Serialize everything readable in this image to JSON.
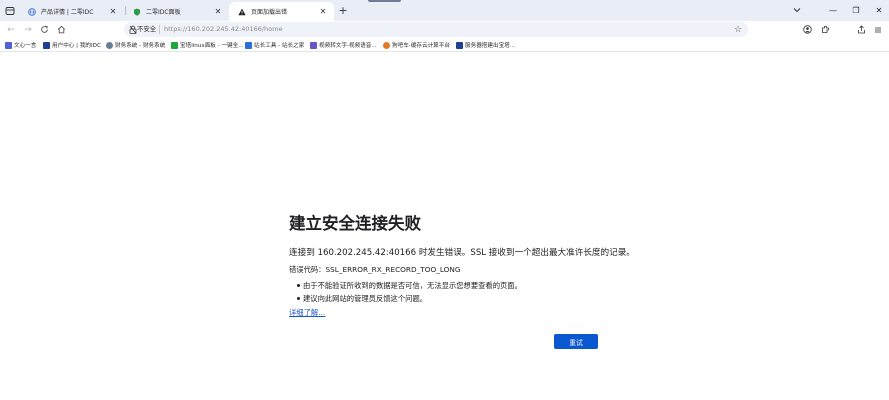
{
  "tabs": [
    {
      "title": "产品详情 | 二零IDC",
      "active": false,
      "icon": "globe-icon"
    },
    {
      "title": "二零IDC面板",
      "active": false,
      "icon": "shield-icon"
    },
    {
      "title": "页面加载出错",
      "active": true,
      "icon": "warning-icon"
    }
  ],
  "window": {
    "minimize": "—",
    "maximize": "❐",
    "close": "✕"
  },
  "toolbar": {
    "security_label": "不安全",
    "url_host": "https://160.202.245.42",
    "url_rest": ":40166/home"
  },
  "bookmarks": [
    {
      "label": "文心一言",
      "icon": "wenxin-icon",
      "color": "#4f63d6"
    },
    {
      "label": "用户中心 | 我的IDC",
      "icon": "idc-icon",
      "color": "#1f3f95"
    },
    {
      "label": "财务系统 - 财务系统",
      "icon": "globe-icon",
      "color": "#6b7c93"
    },
    {
      "label": "宝塔linux面板 - 一键全...",
      "icon": "bt-icon",
      "color": "#20a53a"
    },
    {
      "label": "站长工具 - 站长之家",
      "icon": "chinaz-icon",
      "color": "#2a6fdb"
    },
    {
      "label": "视频转文字-视频语音...",
      "icon": "video-icon",
      "color": "#6c55c7"
    },
    {
      "label": "狗吧车-缓存云计算平台",
      "icon": "cloud-icon",
      "color": "#e07a22"
    },
    {
      "label": "服务器搭建出宝塔...",
      "icon": "server-icon",
      "color": "#1f3f95"
    }
  ],
  "error": {
    "title": "建立安全连接失败",
    "summary": "连接到 160.202.245.42:40166 时发生错误。SSL 接收到一个超出最大准许长度的记录。",
    "code_label": "错误代码：SSL_ERROR_RX_RECORD_TOO_LONG",
    "bullets": [
      "由于不能验证所收到的数据是否可信，无法显示您想要查看的页面。",
      "建议向此网站的管理员反馈这个问题。"
    ],
    "learn_more": "详细了解…",
    "retry": "重试"
  }
}
